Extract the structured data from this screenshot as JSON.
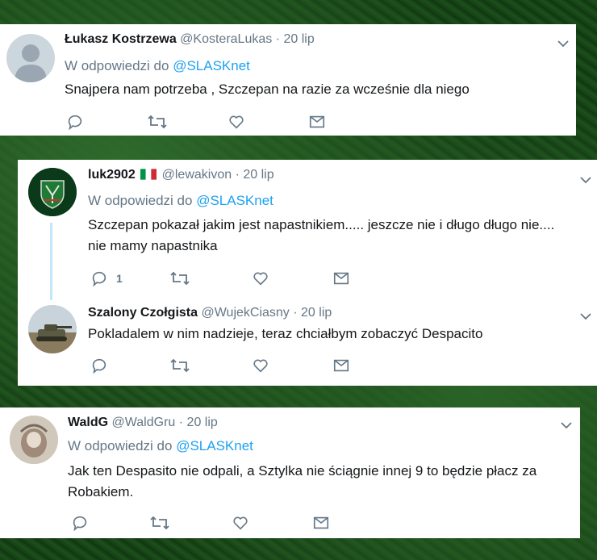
{
  "reply_prefix": "W odpowiedzi do",
  "tweets": [
    {
      "name": "Łukasz Kostrzewa",
      "handle": "@KosteraLukas",
      "sep": "·",
      "time": "20 lip",
      "reply_to": "@SLASKnet",
      "text": "Snajpera nam potrzeba , Szczepan na razie za wcześnie dla niego"
    },
    {
      "name": "luk2902",
      "flag": "italy-flag",
      "handle": "@lewakivon",
      "sep": "·",
      "time": "20 lip",
      "reply_to": "@SLASKnet",
      "text": "Szczepan pokazał jakim jest napastnikiem..... jeszcze nie i długo długo nie.... nie mamy napastnika",
      "reply_count": "1"
    },
    {
      "name": "Szalony Czołgista",
      "handle": "@WujekCiasny",
      "sep": "·",
      "time": "20 lip",
      "text": "Pokladalem w nim nadzieje,  teraz chciałbym zobaczyć Despacito"
    },
    {
      "name": "WaldG",
      "handle": "@WaldGru",
      "sep": "·",
      "time": "20 lip",
      "reply_to": "@SLASKnet",
      "text": "Jak ten Despasito nie odpali, a Sztylka nie ściągnie innej 9 to będzie płacz za Robakiem."
    }
  ],
  "icons": {
    "reply": "reply-icon",
    "retweet": "retweet-icon",
    "like": "heart-icon",
    "dm": "envelope-icon",
    "menu": "chevron-down-icon"
  },
  "colors": {
    "link": "#1da1f2",
    "secondary": "#657786",
    "text": "#14171a",
    "thread_line": "#c4e6fb"
  }
}
